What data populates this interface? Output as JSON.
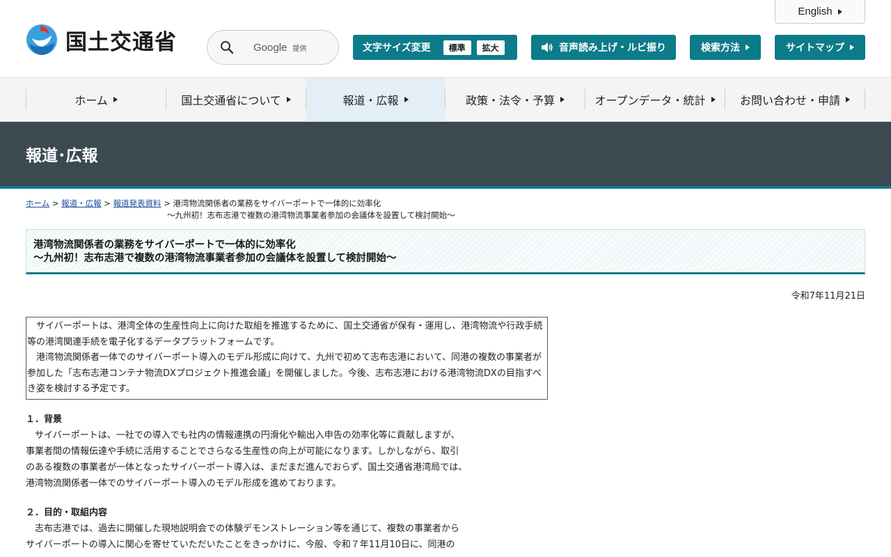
{
  "header": {
    "logo_text": "国土交通省",
    "search": {
      "brand": "Google",
      "brand_sub": "提供"
    },
    "english_label": "English",
    "font_size": {
      "label": "文字サイズ変更",
      "standard": "標準",
      "large": "拡大"
    },
    "voice_label": "音声読み上げ・ルビ振り",
    "howto_label": "検索方法",
    "sitemap_label": "サイトマップ"
  },
  "gnav": {
    "items": [
      {
        "label": "ホーム"
      },
      {
        "label": "国土交通省について"
      },
      {
        "label": "報道・広報"
      },
      {
        "label": "政策・法令・予算"
      },
      {
        "label": "オープンデータ・統計"
      },
      {
        "label": "お問い合わせ・申請"
      }
    ],
    "active_index": 2
  },
  "page_title": "報道･広報",
  "breadcrumb": {
    "home": "ホーム",
    "press": "報道・広報",
    "releases": "報道発表資料",
    "sep": ">",
    "current_line1": "港湾物流関係者の業務をサイバーポートで一体的に効率化",
    "current_line2": "～九州初！志布志港で複数の港湾物流事業者参加の会議体を設置して検討開始～"
  },
  "article": {
    "title_line1": "港湾物流関係者の業務をサイバーポートで一体的に効率化",
    "title_line2": "～九州初！志布志港で複数の港湾物流事業者参加の会議体を設置して検討開始～",
    "date": "令和7年11月21日",
    "summary_p1": "サイバーポートは、港湾全体の生産性向上に向けた取組を推進するために、国土交通省が保有・運用し、港湾物流や行政手続等の港湾関連手続を電子化するデータプラットフォームです。",
    "summary_p2": "港湾物流関係者一体でのサイバーポート導入のモデル形成に向けて、九州で初めて志布志港において、同港の複数の事業者が参加した「志布志港コンテナ物流DXプロジェクト推進会議」を開催しました。今後、志布志港における港湾物流DXの目指すべき姿を検討する予定です。",
    "section1_heading": "１．背景",
    "section1_body": "　サイバーポートは、一社での導入でも社内の情報連携の円滑化や輸出入申告の効率化等に貢献しますが、\n事業者間の情報伝達や手続に活用することでさらなる生産性の向上が可能になります。しかしながら、取引\nのある複数の事業者が一体となったサイバーポート導入は、まだまだ進んでおらず、国土交通省港湾局では、\n港湾物流関係者一体でのサイバーポート導入のモデル形成を進めております。",
    "section2_heading": "２．目的・取組内容",
    "section2_body": "　志布志港では、過去に開催した現地説明会での体験デモンストレーション等を通じて、複数の事業者から\nサイバーポートの導入に関心を寄せていただいたことをきっかけに、今般、令和７年11月10日に、同港の"
  },
  "colors": {
    "accent": "#0c7b8a",
    "title_band": "#3b4a51",
    "link": "#1a4a9c"
  }
}
